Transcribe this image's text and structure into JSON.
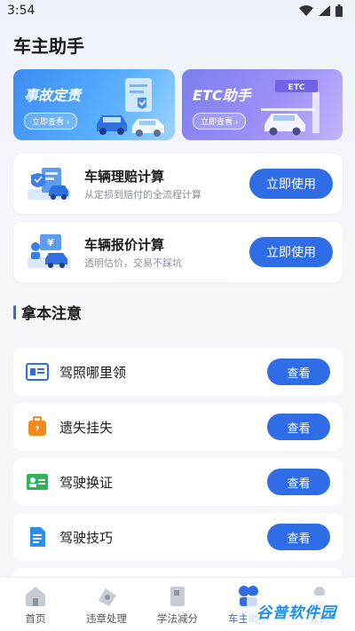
{
  "status_bar": {
    "time": "3:54"
  },
  "page": {
    "title": "车主助手"
  },
  "banners": [
    {
      "title": "事故定责",
      "button": "立即查看 ›"
    },
    {
      "title": "ETC助手",
      "button": "立即查看 ›",
      "sign": "ETC"
    }
  ],
  "calculators": [
    {
      "title": "车辆理赔计算",
      "subtitle": "从定损到赔付的全流程计算",
      "button": "立即使用"
    },
    {
      "title": "车辆报价计算",
      "subtitle": "透明估价，交易不踩坑",
      "button": "立即使用"
    }
  ],
  "section": {
    "title": "拿本注意"
  },
  "notes": [
    {
      "label": "驾照哪里领",
      "button": "查看",
      "icon": "id-card-icon"
    },
    {
      "label": "遗失挂失",
      "button": "查看",
      "icon": "suitcase-icon"
    },
    {
      "label": "驾驶换证",
      "button": "查看",
      "icon": "license-card-icon"
    },
    {
      "label": "驾驶技巧",
      "button": "查看",
      "icon": "document-icon"
    }
  ],
  "bottom_nav": [
    {
      "label": "首页",
      "icon": "home-icon"
    },
    {
      "label": "违章处理",
      "icon": "violation-icon"
    },
    {
      "label": "学法减分",
      "icon": "book-icon"
    },
    {
      "label": "车主助手",
      "icon": "assistant-icon",
      "active": true
    },
    {
      "label": "我的",
      "icon": "profile-icon"
    }
  ],
  "watermark": "谷普软件园",
  "colors": {
    "primary": "#2e6de6",
    "banner_blue": "#3b8cf2",
    "banner_purple": "#8a87f2"
  }
}
